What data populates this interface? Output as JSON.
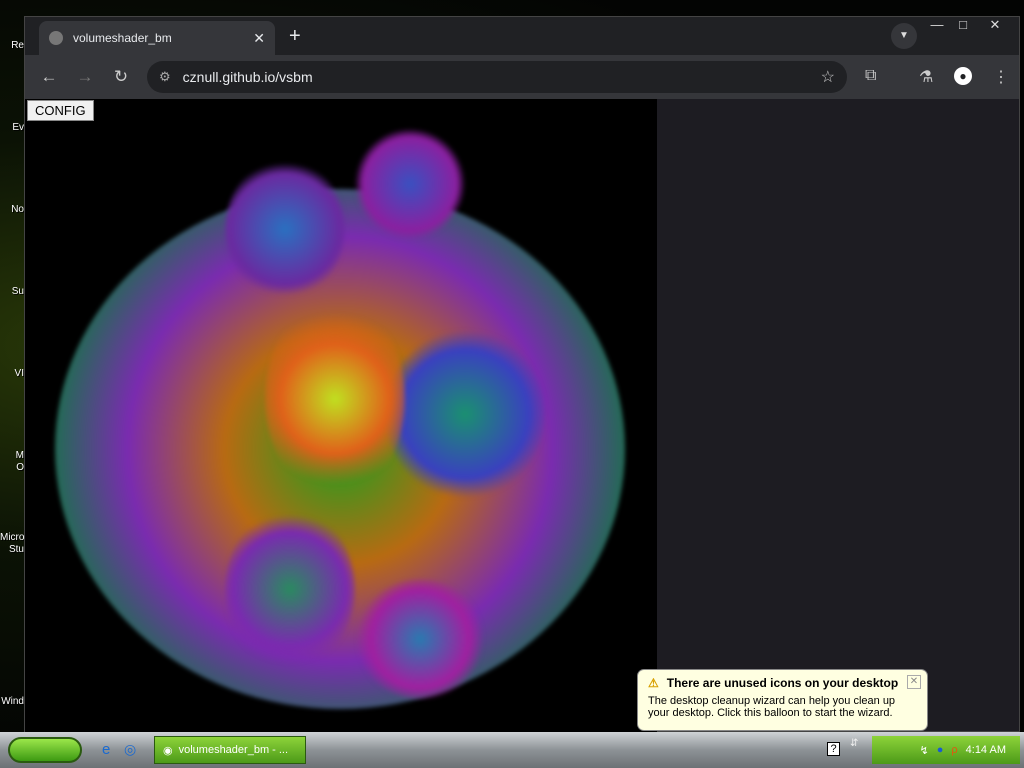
{
  "desktop": {
    "icons": [
      "Re",
      "Ev",
      "No",
      "Su",
      "VI",
      "M\nO",
      "Micro\nStu",
      "Wind"
    ]
  },
  "browser": {
    "tab_title": "volumeshader_bm",
    "url": "cznull.github.io/vsbm",
    "config_label": "CONFIG"
  },
  "balloon": {
    "title": "There are unused icons on your desktop",
    "body": "The desktop cleanup wizard can help you clean up your desktop. Click this balloon to start the wizard."
  },
  "taskbar": {
    "task_label": "volumeshader_bm - ...",
    "clock": "4:14 AM"
  }
}
